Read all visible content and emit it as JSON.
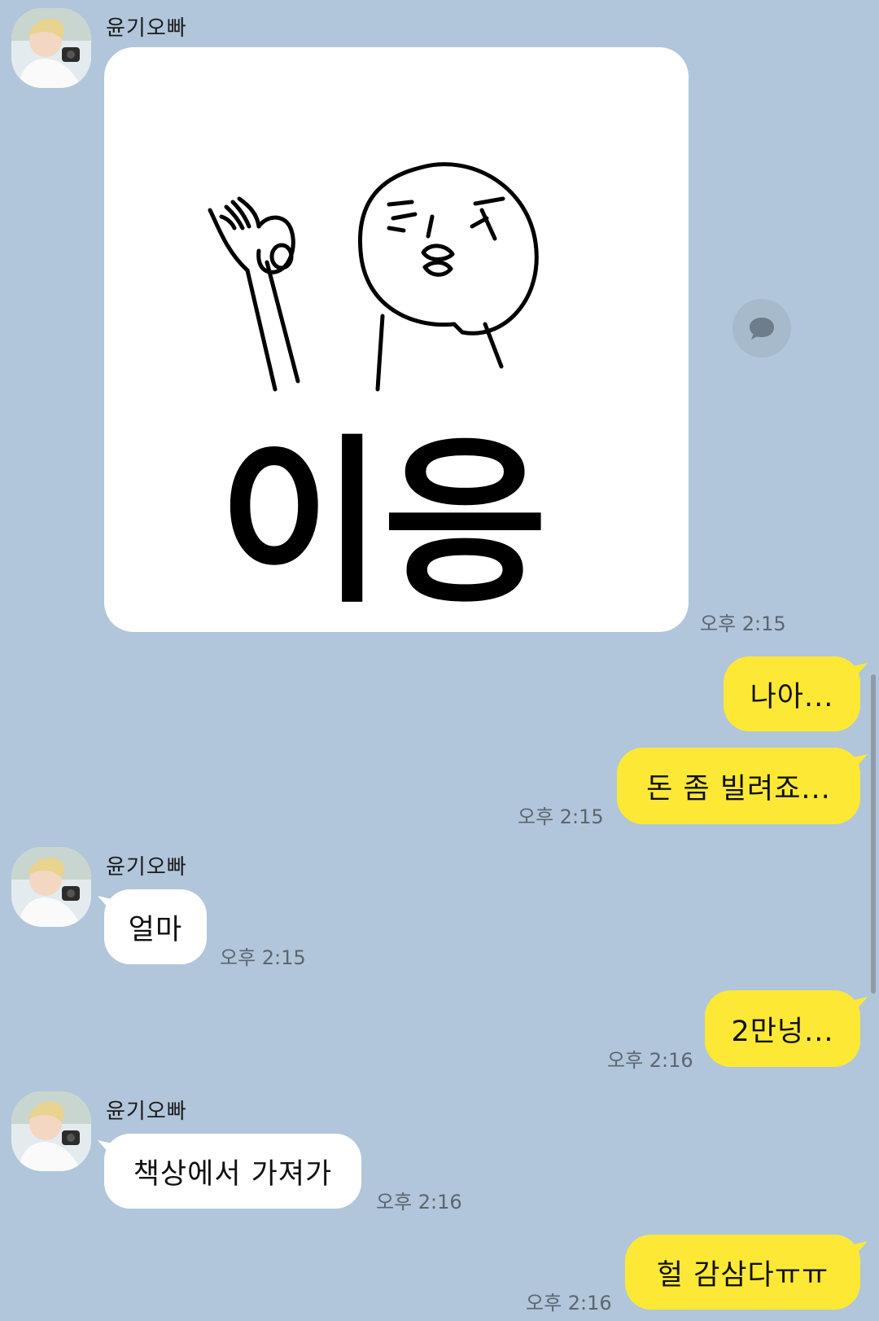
{
  "chat": {
    "contact_name": "윤기오빠",
    "colors": {
      "background": "#b1c6da",
      "my_bubble": "#fde935",
      "their_bubble": "#ffffff"
    },
    "messages": [
      {
        "from": "them",
        "type": "sticker",
        "sticker_text": "이응",
        "time": "오후 2:15"
      },
      {
        "from": "me",
        "type": "text",
        "text": "나아...",
        "time": ""
      },
      {
        "from": "me",
        "type": "text",
        "text": "돈 좀 빌려죠...",
        "time": "오후 2:15"
      },
      {
        "from": "them",
        "type": "text",
        "text": "얼마",
        "time": "오후 2:15"
      },
      {
        "from": "me",
        "type": "text",
        "text": "2만넝...",
        "time": "오후 2:16"
      },
      {
        "from": "them",
        "type": "text",
        "text": "책상에서 가져가",
        "time": "오후 2:16"
      },
      {
        "from": "me",
        "type": "text",
        "text": "헐 감삼다ㅠㅠ",
        "time": "오후 2:16"
      }
    ],
    "icons": {
      "share": "speech-bubble-icon",
      "avatar": "profile-photo"
    }
  }
}
